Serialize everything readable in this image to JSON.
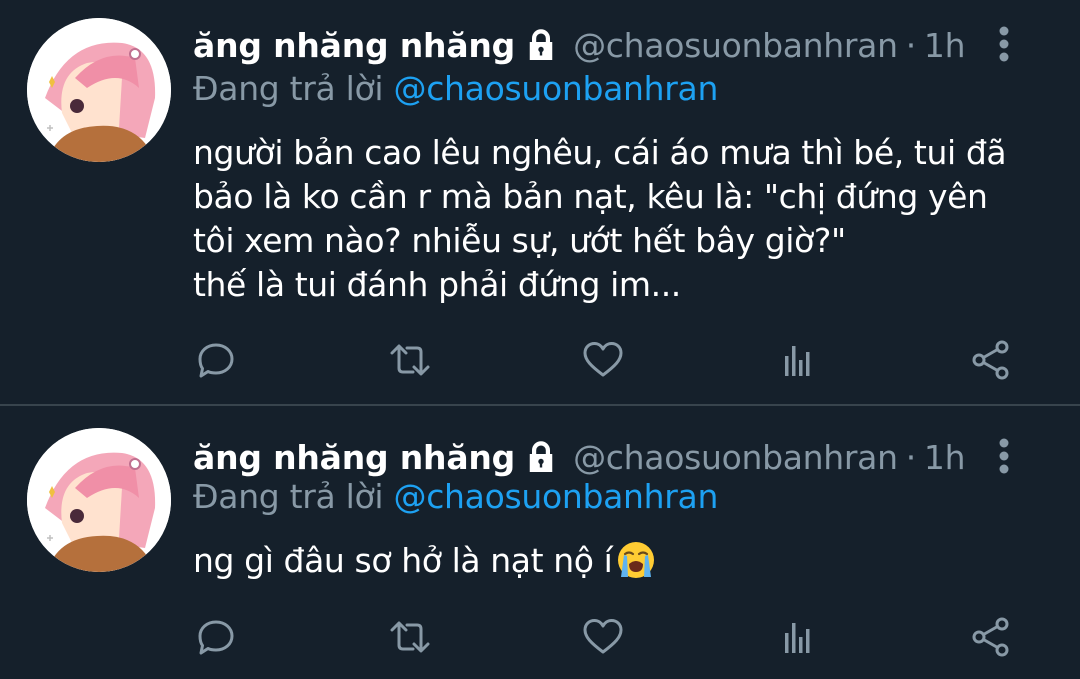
{
  "colors": {
    "background": "#15202b",
    "divider": "#38444d",
    "primary_text": "#ffffff",
    "secondary_text": "#8899a6",
    "accent": "#1da1f2"
  },
  "tweets": [
    {
      "display_name": "ăng nhăng nhăng",
      "handle": "@chaosuonbanhran",
      "separator": "·",
      "time": "1h",
      "reply_prefix": "Đang trả lời",
      "reply_to": "@chaosuonbanhran",
      "body_lines": [
        "người bản cao lêu nghêu, cái áo mưa thì bé, tui đã",
        "bảo là ko cần r mà bản nạt, kêu là: \"chị đứng yên",
        "tôi xem nào? nhiễu sự, ướt hết bây giờ?\"",
        "thế là tui đánh phải đứng im..."
      ],
      "icons": {
        "avatar": "anime-pink-hair-avatar",
        "lock": "lock-icon",
        "more": "more-vertical-icon",
        "reply": "reply-icon",
        "retweet": "retweet-icon",
        "like": "heart-icon",
        "stats": "analytics-icon",
        "share": "share-icon"
      }
    },
    {
      "display_name": "ăng nhăng nhăng",
      "handle": "@chaosuonbanhran",
      "separator": "·",
      "time": "1h",
      "reply_prefix": "Đang trả lời",
      "reply_to": "@chaosuonbanhran",
      "body_lines": [
        "ng gì đâu sơ hở là nạt nộ í"
      ],
      "emoji": "loudly-crying-face-emoji",
      "icons": {
        "avatar": "anime-pink-hair-avatar",
        "lock": "lock-icon",
        "more": "more-vertical-icon",
        "reply": "reply-icon",
        "retweet": "retweet-icon",
        "like": "heart-icon",
        "stats": "analytics-icon",
        "share": "share-icon"
      }
    }
  ]
}
